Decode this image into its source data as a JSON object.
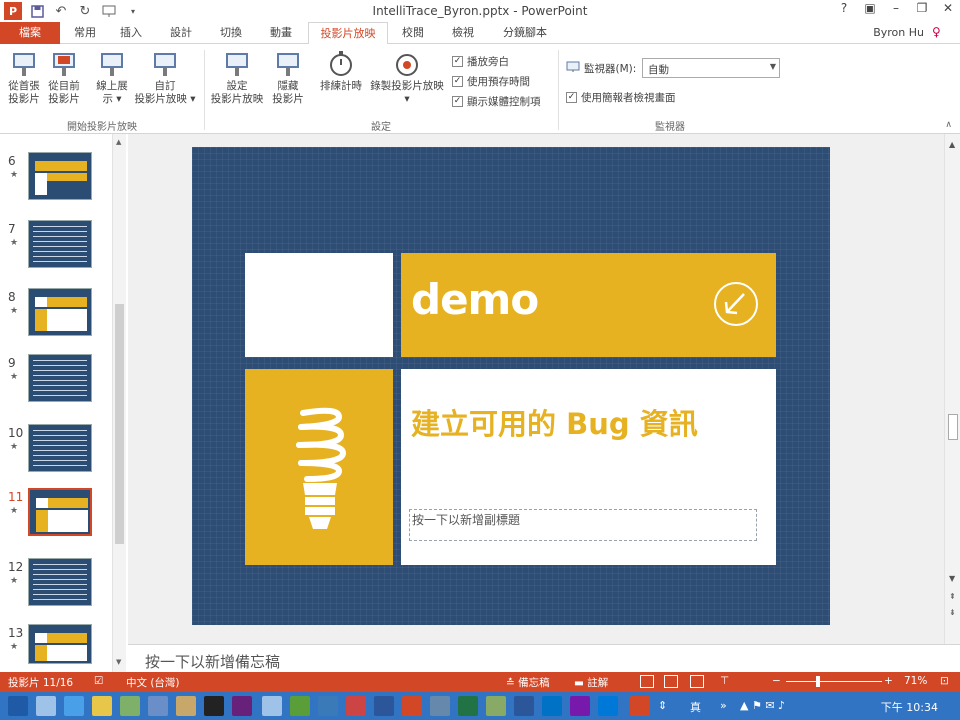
{
  "window": {
    "title": "IntelliTrace_Byron.pptx - PowerPoint",
    "user": "Byron Hu",
    "controls": [
      "?",
      "▣",
      "–",
      "❐",
      "✕"
    ]
  },
  "qat": [
    "save-icon",
    "undo-icon",
    "redo-icon",
    "start-from-beginning-icon"
  ],
  "tabs": [
    "檔案",
    "常用",
    "插入",
    "設計",
    "切換",
    "動畫",
    "投影片放映",
    "校閱",
    "檢視",
    "分鏡腳本"
  ],
  "active_tab": "投影片放映",
  "ribbon": {
    "group1": {
      "label": "開始投影片放映",
      "buttons": [
        {
          "line1": "從首張",
          "line2": "投影片"
        },
        {
          "line1": "從目前",
          "line2": "投影片"
        },
        {
          "line1": "線上展",
          "line2": "示 ▾"
        },
        {
          "line1": "自訂",
          "line2": "投影片放映 ▾"
        }
      ]
    },
    "group2": {
      "label": "設定",
      "buttons": [
        {
          "line1": "設定",
          "line2": "投影片放映"
        },
        {
          "line1": "隱藏",
          "line2": "投影片"
        },
        {
          "line1": "排練計時",
          "line2": ""
        },
        {
          "line1": "錄製投影片放映",
          "line2": "▾"
        }
      ],
      "checks": [
        {
          "label": "播放旁白",
          "checked": true
        },
        {
          "label": "使用預存時間",
          "checked": true
        },
        {
          "label": "顯示媒體控制項",
          "checked": true
        }
      ]
    },
    "group3": {
      "label": "監視器",
      "monitor_label": "監視器(M):",
      "monitor_value": "自動",
      "presenter_view": {
        "label": "使用簡報者檢視畫面",
        "checked": true
      }
    }
  },
  "thumbnails": [
    {
      "num": "6",
      "star": "★"
    },
    {
      "num": "7",
      "star": "★"
    },
    {
      "num": "8",
      "star": "★"
    },
    {
      "num": "9",
      "star": "★"
    },
    {
      "num": "10",
      "star": "★"
    },
    {
      "num": "11",
      "star": "★",
      "selected": true
    },
    {
      "num": "12",
      "star": "★"
    },
    {
      "num": "13",
      "star": "★"
    }
  ],
  "slide": {
    "demo_text": "demo",
    "title": "建立可用的 Bug 資訊",
    "subtitle_placeholder": "按一下以新增副標題"
  },
  "notes_placeholder": "按一下以新增備忘稿",
  "status": {
    "slide_info": "投影片 11/16",
    "language": "中文 (台灣)",
    "notes_btn": "備忘稿",
    "comments_btn": "註解",
    "zoom": "71%",
    "zoom_minus": "−",
    "zoom_plus": "+"
  },
  "taskbar": {
    "tray_text": "真",
    "time": "下午 10:34"
  },
  "colors": {
    "accent": "#d24726",
    "slide_bg": "#2d4d74",
    "slide_yellow": "#e6b222",
    "taskbar": "#3174c4"
  }
}
